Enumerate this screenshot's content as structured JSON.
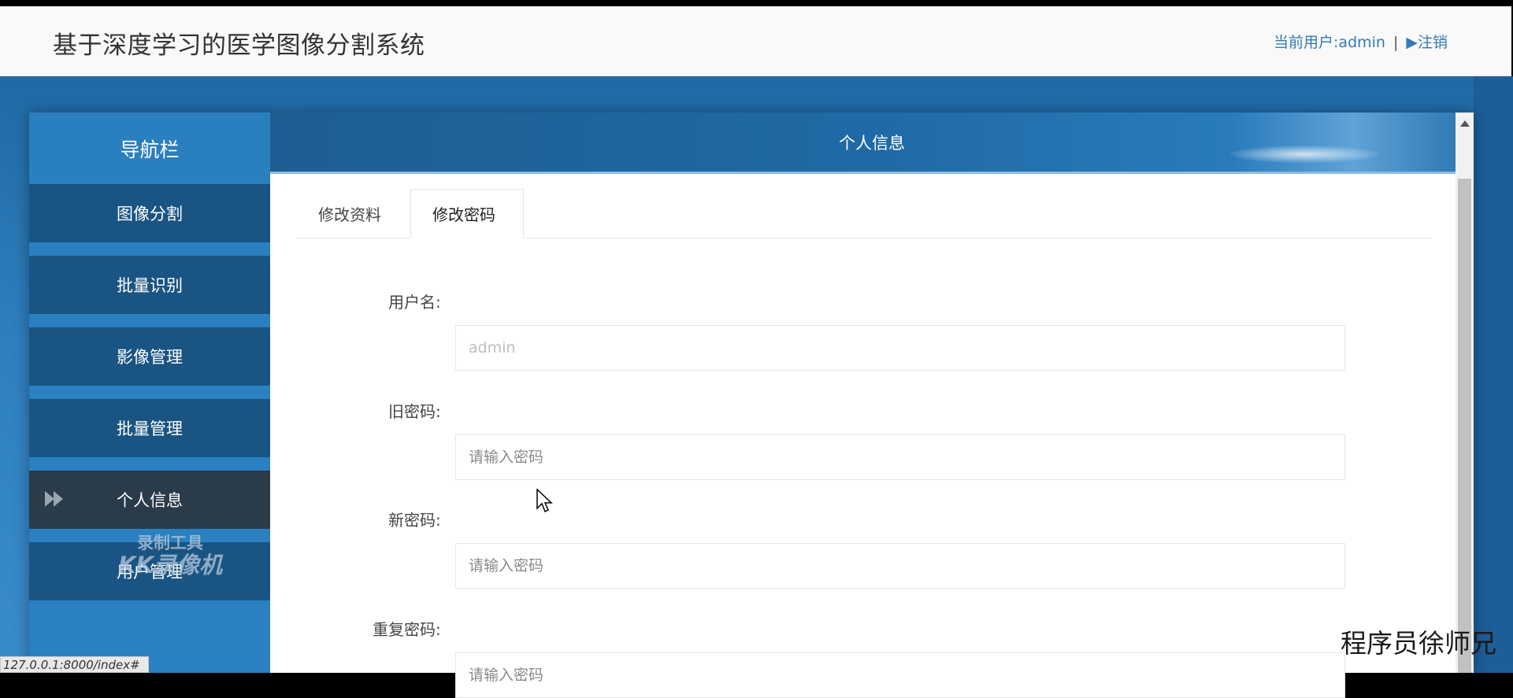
{
  "app": {
    "title": "基于深度学习的医学图像分割系统",
    "current_user": "当前用户:admin",
    "separator": "|",
    "logout": "▶注销"
  },
  "sidebar": {
    "header": "导航栏",
    "items": [
      {
        "label": "图像分割",
        "active": false
      },
      {
        "label": "批量识别",
        "active": false
      },
      {
        "label": "影像管理",
        "active": false
      },
      {
        "label": "批量管理",
        "active": false
      },
      {
        "label": "个人信息",
        "active": true
      },
      {
        "label": "用户管理",
        "active": false
      }
    ]
  },
  "content": {
    "header": "个人信息",
    "tabs": [
      {
        "label": "修改资料",
        "active": false
      },
      {
        "label": "修改密码",
        "active": true
      }
    ],
    "form": {
      "username_label": "用户名:",
      "username_placeholder": "admin",
      "old_password_label": "旧密码:",
      "old_password_placeholder": "请输入密码",
      "new_password_label": "新密码:",
      "new_password_placeholder": "请输入密码",
      "repeat_password_label": "重复密码:",
      "repeat_password_placeholder": "请输入密码"
    }
  },
  "overlay": {
    "watermark_line1": "录制工具",
    "watermark_line2": "KK录像机",
    "author": "程序员徐师兄",
    "status_url": "127.0.0.1:8000/index#"
  },
  "colors": {
    "accent": "#337ab7",
    "sidebar_item": "#1a5482",
    "sidebar_active": "#2a3b4a",
    "background": "#2a7fbf"
  }
}
